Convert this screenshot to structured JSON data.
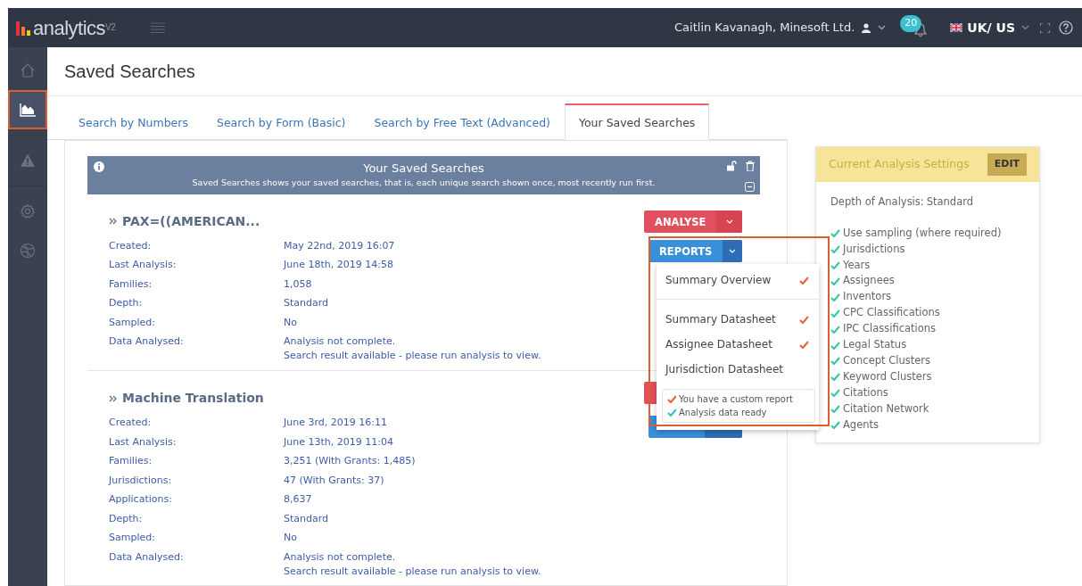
{
  "topbar": {
    "logo": "analytics$^{V2}$",
    "user": "Caitlin Kavanagh, Minesoft Ltd.",
    "notifications": "20",
    "region": "UK/ US"
  },
  "sidebar": {
    "items": [
      {
        "kind": "home",
        "selected": false,
        "highlighted": false
      },
      {
        "kind": "chart",
        "selected": true,
        "highlighted": true
      },
      {
        "kind": "warning",
        "selected": false,
        "highlighted": false
      },
      {
        "kind": "gear",
        "selected": false,
        "highlighted": false
      },
      {
        "kind": "globe",
        "selected": false,
        "highlighted": false
      }
    ]
  },
  "page_title": "Saved Searches",
  "tabs": [
    {
      "label": "Search by Numbers",
      "selected": false
    },
    {
      "label": "Search by Form (Basic)",
      "selected": false
    },
    {
      "label": "Search by Free Text (Advanced)",
      "selected": false
    },
    {
      "label": "Your Saved Searches",
      "selected": true
    }
  ],
  "panel": {
    "title": "Your Saved Searches",
    "subtitle": "Saved Searches shows your saved searches, that is, each unique search shown once, most recently run first.",
    "searches": [
      {
        "title": "PAX=((AMERICAN...",
        "analyse": "ANALYSE",
        "reports": "REPORTS",
        "rows": [
          {
            "label": "Created:",
            "lines": [
              "May 22nd, 2019 16:07"
            ]
          },
          {
            "label": "Last Analysis:",
            "lines": [
              "June 18th, 2019 14:58"
            ]
          },
          {
            "label": "Families:",
            "lines": [
              "1,058"
            ]
          },
          {
            "label": "Depth:",
            "lines": [
              "Standard"
            ]
          },
          {
            "label": "Sampled:",
            "lines": [
              "No"
            ]
          },
          {
            "label": "Data Analysed:",
            "lines": [
              "Analysis not complete.",
              "Search result available - please run analysis to view."
            ]
          }
        ]
      },
      {
        "title": "Machine Translation",
        "rows": [
          {
            "label": "Created:",
            "lines": [
              "June 3rd, 2019 16:11"
            ]
          },
          {
            "label": "Last Analysis:",
            "lines": [
              "June 13th, 2019 11:04"
            ]
          },
          {
            "label": "Families:",
            "lines": [
              "3,251 (With Grants: 1,485)"
            ]
          },
          {
            "label": "Jurisdictions:",
            "lines": [
              "47 (With Grants: 37)"
            ]
          },
          {
            "label": "Applications:",
            "lines": [
              "8,637"
            ]
          },
          {
            "label": "Depth:",
            "lines": [
              "Standard"
            ]
          },
          {
            "label": "Sampled:",
            "lines": [
              "No"
            ]
          },
          {
            "label": "Data Analysed:",
            "lines": [
              "Analysis not complete.",
              "Search result available - please run analysis to view."
            ]
          }
        ]
      }
    ]
  },
  "reports_menu": {
    "highlighted": true,
    "items": [
      {
        "label": "Summary Overview",
        "checked": true,
        "divider_after": true
      },
      {
        "label": "Summary Datasheet",
        "checked": true,
        "divider_after": false
      },
      {
        "label": "Assignee Datasheet",
        "checked": true,
        "divider_after": false
      },
      {
        "label": "Jurisdiction Datasheet",
        "checked": false,
        "divider_after": false
      }
    ],
    "legend": [
      {
        "label": "You have a custom report",
        "color": "#e8653f"
      },
      {
        "label": "Analysis data ready",
        "color": "#3cbfd0"
      }
    ]
  },
  "settings": {
    "title": "Current Analysis Settings",
    "edit": "EDIT",
    "depth_label": "Depth of Analysis:",
    "depth_value": "Standard",
    "items": [
      {
        "label": "Use sampling (where required)",
        "checked": true
      },
      {
        "label": "Jurisdictions",
        "checked": true
      },
      {
        "label": "Years",
        "checked": true
      },
      {
        "label": "Assignees",
        "checked": true
      },
      {
        "label": "Inventors",
        "checked": true
      },
      {
        "label": "CPC Classifications",
        "checked": true
      },
      {
        "label": "IPC Classifications",
        "checked": true
      },
      {
        "label": "Legal Status",
        "checked": true
      },
      {
        "label": "Concept Clusters",
        "checked": true
      },
      {
        "label": "Keyword Clusters",
        "checked": true
      },
      {
        "label": "Citations",
        "checked": true
      },
      {
        "label": "Citation Network",
        "checked": true
      },
      {
        "label": "Agents",
        "checked": true
      }
    ]
  }
}
